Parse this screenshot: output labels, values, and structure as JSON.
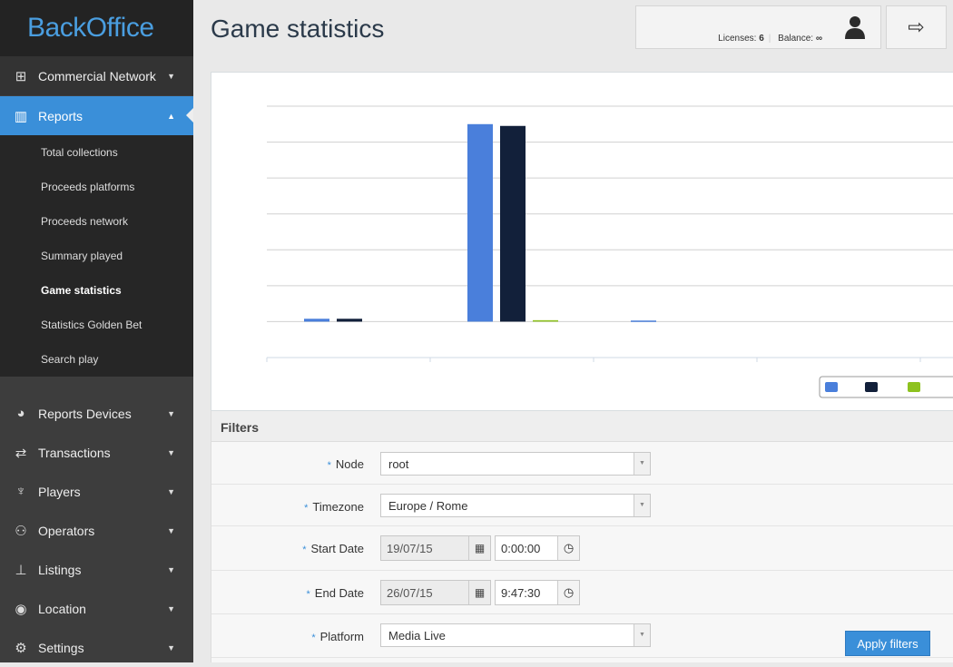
{
  "app": {
    "logo": "BackOffice"
  },
  "header": {
    "title": "Game statistics",
    "licenses_label": "Licenses:",
    "licenses": "6",
    "balance_label": "Balance:",
    "balance": "∞"
  },
  "sidebar": {
    "top": [
      {
        "label": "Commercial Network",
        "icon": "sitemap-icon"
      },
      {
        "label": "Reports",
        "icon": "bar-chart-icon",
        "active": true
      }
    ],
    "sub": [
      "Total collections",
      "Proceeds platforms",
      "Proceeds network",
      "Summary played",
      "Game statistics",
      "Statistics Golden Bet",
      "Search play"
    ],
    "current_sub": "Game statistics",
    "bottom": [
      {
        "label": "Reports Devices",
        "icon": "dashboard-icon"
      },
      {
        "label": "Transactions",
        "icon": "exchange-icon"
      },
      {
        "label": "Players",
        "icon": "trophy-icon"
      },
      {
        "label": "Operators",
        "icon": "users-icon"
      },
      {
        "label": "Listings",
        "icon": "pushpin-icon"
      },
      {
        "label": "Location",
        "icon": "globe-icon"
      },
      {
        "label": "Settings",
        "icon": "gear-icon"
      }
    ]
  },
  "chart_data": {
    "type": "bar",
    "categories": [
      "",
      "",
      "",
      "",
      ""
    ],
    "series": [
      {
        "color": "#4a7fdb",
        "values": [
          0.08,
          5.5,
          0.03,
          0,
          0
        ]
      },
      {
        "color": "#12203a",
        "values": [
          0.08,
          5.45,
          0,
          0,
          0
        ]
      },
      {
        "color": "#8dc21f",
        "values": [
          0,
          0.04,
          0,
          0,
          0
        ]
      }
    ],
    "ylim": [
      -1,
      6
    ],
    "grid": true,
    "legend": "bottom-right"
  },
  "filters": {
    "title": "Filters",
    "node": {
      "label": "Node",
      "value": "root"
    },
    "timezone": {
      "label": "Timezone",
      "value": "Europe / Rome"
    },
    "start": {
      "label": "Start Date",
      "date": "19/07/15",
      "time": "0:00:00"
    },
    "end": {
      "label": "End Date",
      "date": "26/07/15",
      "time": "9:47:30"
    },
    "platform": {
      "label": "Platform",
      "value": "Media Live"
    },
    "apply": "Apply filters",
    "required_mark": "*"
  }
}
